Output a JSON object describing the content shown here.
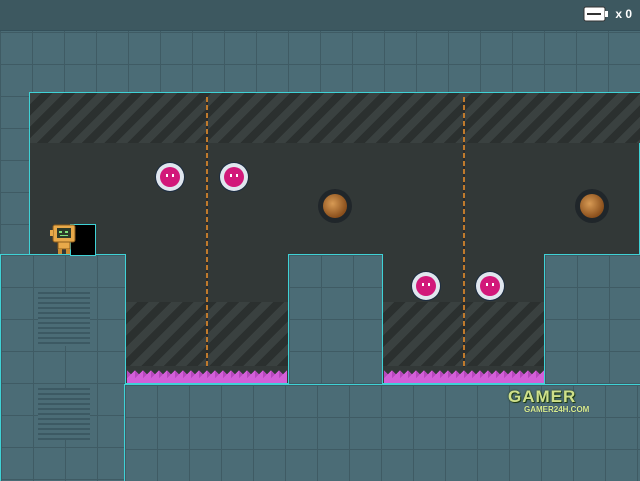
{
  "hud": {
    "item_icon": "battery-icon",
    "count_label": "x 0"
  },
  "logo": {
    "title": "GAMER",
    "subtitle": "GAMER24H.COM"
  },
  "colors": {
    "wall": "#4b6c76",
    "room": "#323837",
    "edge": "#3fd2d6",
    "spikes": "#d35fd8",
    "orb": "#d2187a"
  }
}
